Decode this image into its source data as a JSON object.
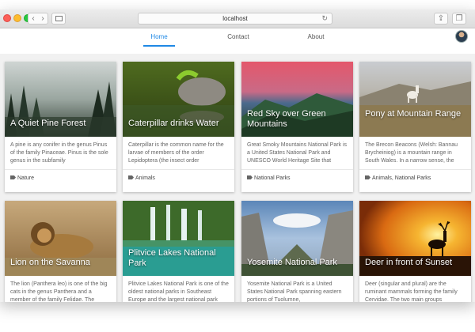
{
  "browser": {
    "url": "localhost",
    "back_icon": "chevron-left-icon",
    "forward_icon": "chevron-right-icon"
  },
  "nav": {
    "links": [
      {
        "label": "Home",
        "active": true
      },
      {
        "label": "About"
      },
      {
        "label": "Contact"
      }
    ],
    "accent_color": "#1e88e5"
  },
  "cards": [
    {
      "title": "A Quiet Pine Forest",
      "description": "A pine is any conifer in the genus Pinus of the family Pinaceae. Pinus is the sole genus in the subfamily",
      "tags": "Nature"
    },
    {
      "title": "Caterpillar drinks Water",
      "description": "Caterpillar is the common name for the larvae of members of the order Lepidoptera (the insect order",
      "tags": "Animals"
    },
    {
      "title": "Red Sky over Green Mountains",
      "description": "Great Smoky Mountains National Park is a United States National Park and UNESCO World Heritage Site that",
      "tags": "National Parks"
    },
    {
      "title": "Pony at Mountain Range",
      "description": "The Brecon Beacons (Welsh: Bannau Brycheiniog) is a mountain range in South Wales. In a narrow sense, the",
      "tags": "Animals, National Parks"
    },
    {
      "title": "Lion on the Savanna",
      "description": "The lion (Panthera leo) is one of the big cats in the genus Panthera and a member of the family Felidae. The",
      "tags": ""
    },
    {
      "title": "Plitvice Lakes National Park",
      "description": "Plitvice Lakes National Park is one of the oldest national parks in Southeast Europe and the largest national park",
      "tags": ""
    },
    {
      "title": "Yosemite National Park",
      "description": "Yosemite National Park is a United States National Park spanning eastern portions of Tuolumne,",
      "tags": ""
    },
    {
      "title": "Deer in front of Sunset",
      "description": "Deer (singular and plural) are the ruminant mammals forming the family Cervidae. The two main groups",
      "tags": ""
    }
  ]
}
